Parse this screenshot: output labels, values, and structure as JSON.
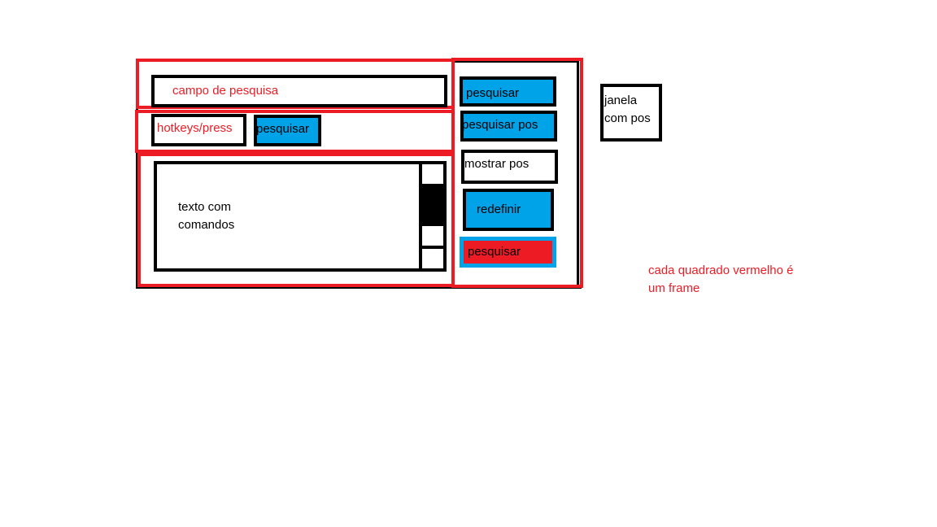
{
  "colors": {
    "frame_red": "#ed1c24",
    "button_blue": "#00a2e8",
    "border_black": "#000000"
  },
  "left_panel": {
    "search_field_label": "campo de pesquisa",
    "hotkeys_field_label": "hotkeys/press",
    "search_button_label": "pesquisar",
    "text_area_text": "texto com\ncomandos"
  },
  "right_panel": {
    "buttons": [
      {
        "label": "pesquisar",
        "style": "blue"
      },
      {
        "label": "pesquisar pos",
        "style": "blue"
      },
      {
        "label": "mostrar pos",
        "style": "white"
      },
      {
        "label": "redefinir",
        "style": "blue"
      },
      {
        "label": "pesquisar",
        "style": "red-with-blue-border"
      }
    ]
  },
  "pos_window": {
    "text": "janela\ncom pos"
  },
  "annotation": {
    "text": "cada quadrado vermelho é\num frame"
  }
}
